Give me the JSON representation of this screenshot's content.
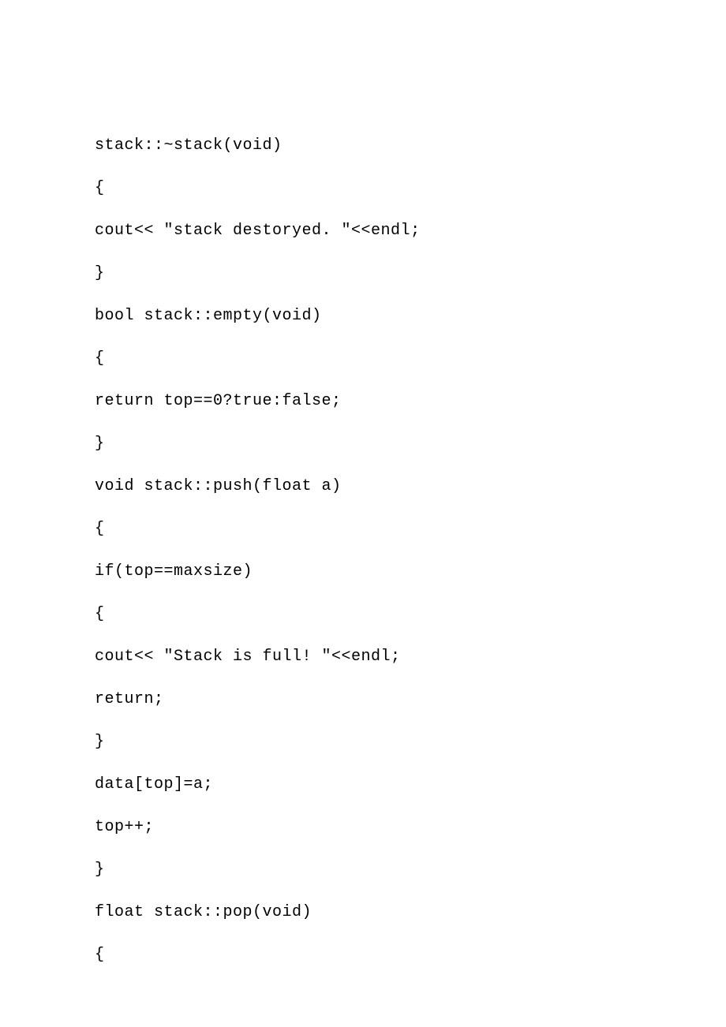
{
  "code": {
    "lines": [
      "stack::~stack(void)",
      "{",
      "cout<< \"stack destoryed. \"<<endl;",
      "}",
      "bool stack::empty(void)",
      "{",
      "return top==0?true:false;",
      "}",
      "void stack::push(float a)",
      "{",
      "if(top==maxsize)",
      "{",
      "cout<< \"Stack is full! \"<<endl;",
      "return;",
      "}",
      "data[top]=a;",
      "top++;",
      "}",
      "float stack::pop(void)",
      "{"
    ]
  }
}
